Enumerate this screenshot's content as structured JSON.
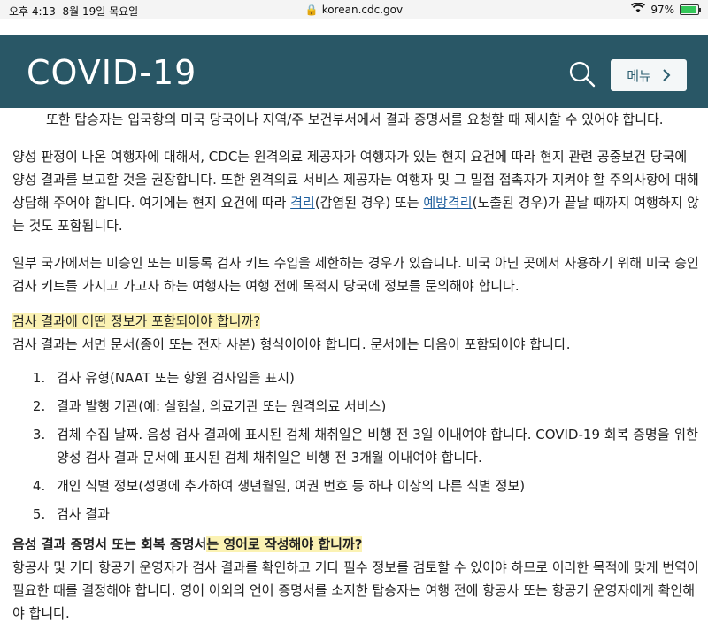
{
  "statusbar": {
    "time": "오후 4:13",
    "date": "8월 19일 목요일",
    "url": "korean.cdc.gov",
    "battery": "97%"
  },
  "header": {
    "brand": "COVID-19",
    "menu_label": "메뉴",
    "search_icon": "search-icon",
    "colors": {
      "bar": "#295766",
      "menu_bg": "#f4f7f8"
    }
  },
  "content": {
    "p1": "또한 탑승자는 입국항의 미국 당국이나 지역/주 보건부서에서 결과 증명서를 요청할 때 제시할 수 있어야 합니다.",
    "p2_before": "양성 판정이 나온 여행자에 대해서, CDC는 원격의료 제공자가 여행자가 있는 현지 요건에 따라 현지 관련 공중보건 당국에 양성 결과를 보고할 것을 권장합니다. 또한 원격의료 서비스 제공자는 여행자 및 그 밀접 접촉자가 지켜야 할 주의사항에 대해 상담해 주어야 합니다. 여기에는 현지 요건에 따라 ",
    "p2_link1": "격리",
    "p2_middle": "(감염된 경우) 또는 ",
    "p2_link2": "예방격리",
    "p2_after": "(노출된 경우)가 끝날 때까지 여행하지 않는 것도 포함됩니다.",
    "p3": "일부 국가에서는 미승인 또는 미등록 검사 키트 수입을 제한하는 경우가 있습니다. 미국 아닌 곳에서 사용하기 위해 미국 승인 검사 키트를 가지고 가고자 하는 여행자는 여행 전에 목적지 당국에 정보를 문의해야 합니다.",
    "heading1": "검사 결과에 어떤 정보가 포함되어야 합니까?",
    "p4": "검사 결과는 서면 문서(종이 또는 전자 사본) 형식이어야 합니다. 문서에는 다음이 포함되어야 합니다.",
    "list": [
      "검사 유형(NAAT 또는 항원 검사임을 표시)",
      "결과 발행 기관(예: 실험실, 의료기관 또는 원격의료 서비스)",
      "검체 수집 날짜. 음성 검사 결과에 표시된 검체 채취일은 비행 전 3일 이내여야 합니다. COVID-19 회복 증명을 위한 양성 검사 결과 문서에 표시된 검체 채취일은 비행 전 3개월 이내여야 합니다.",
      "개인 식별 정보(성명에 추가하여 생년월일, 여권 번호 등 하나 이상의 다른 식별 정보)",
      "검사 결과"
    ],
    "heading2_a": "음성 결과 증명서 또는 회복 증명서",
    "heading2_b": "는 영어로 작성해야 합니까?",
    "p5": "항공사 및 기타 항공기 운영자가 검사 결과를 확인하고 기타 필수 정보를 검토할 수 있어야 하므로 이러한 목적에 맞게 번역이 필요한 때를 결정해야 합니다. 영어 이외의 언어 증명서를 소지한 탑승자는 여행 전에 항공사 또는 항공기 운영자에게 확인해야 합니다.",
    "highlight_color": "#fbf2b3"
  }
}
